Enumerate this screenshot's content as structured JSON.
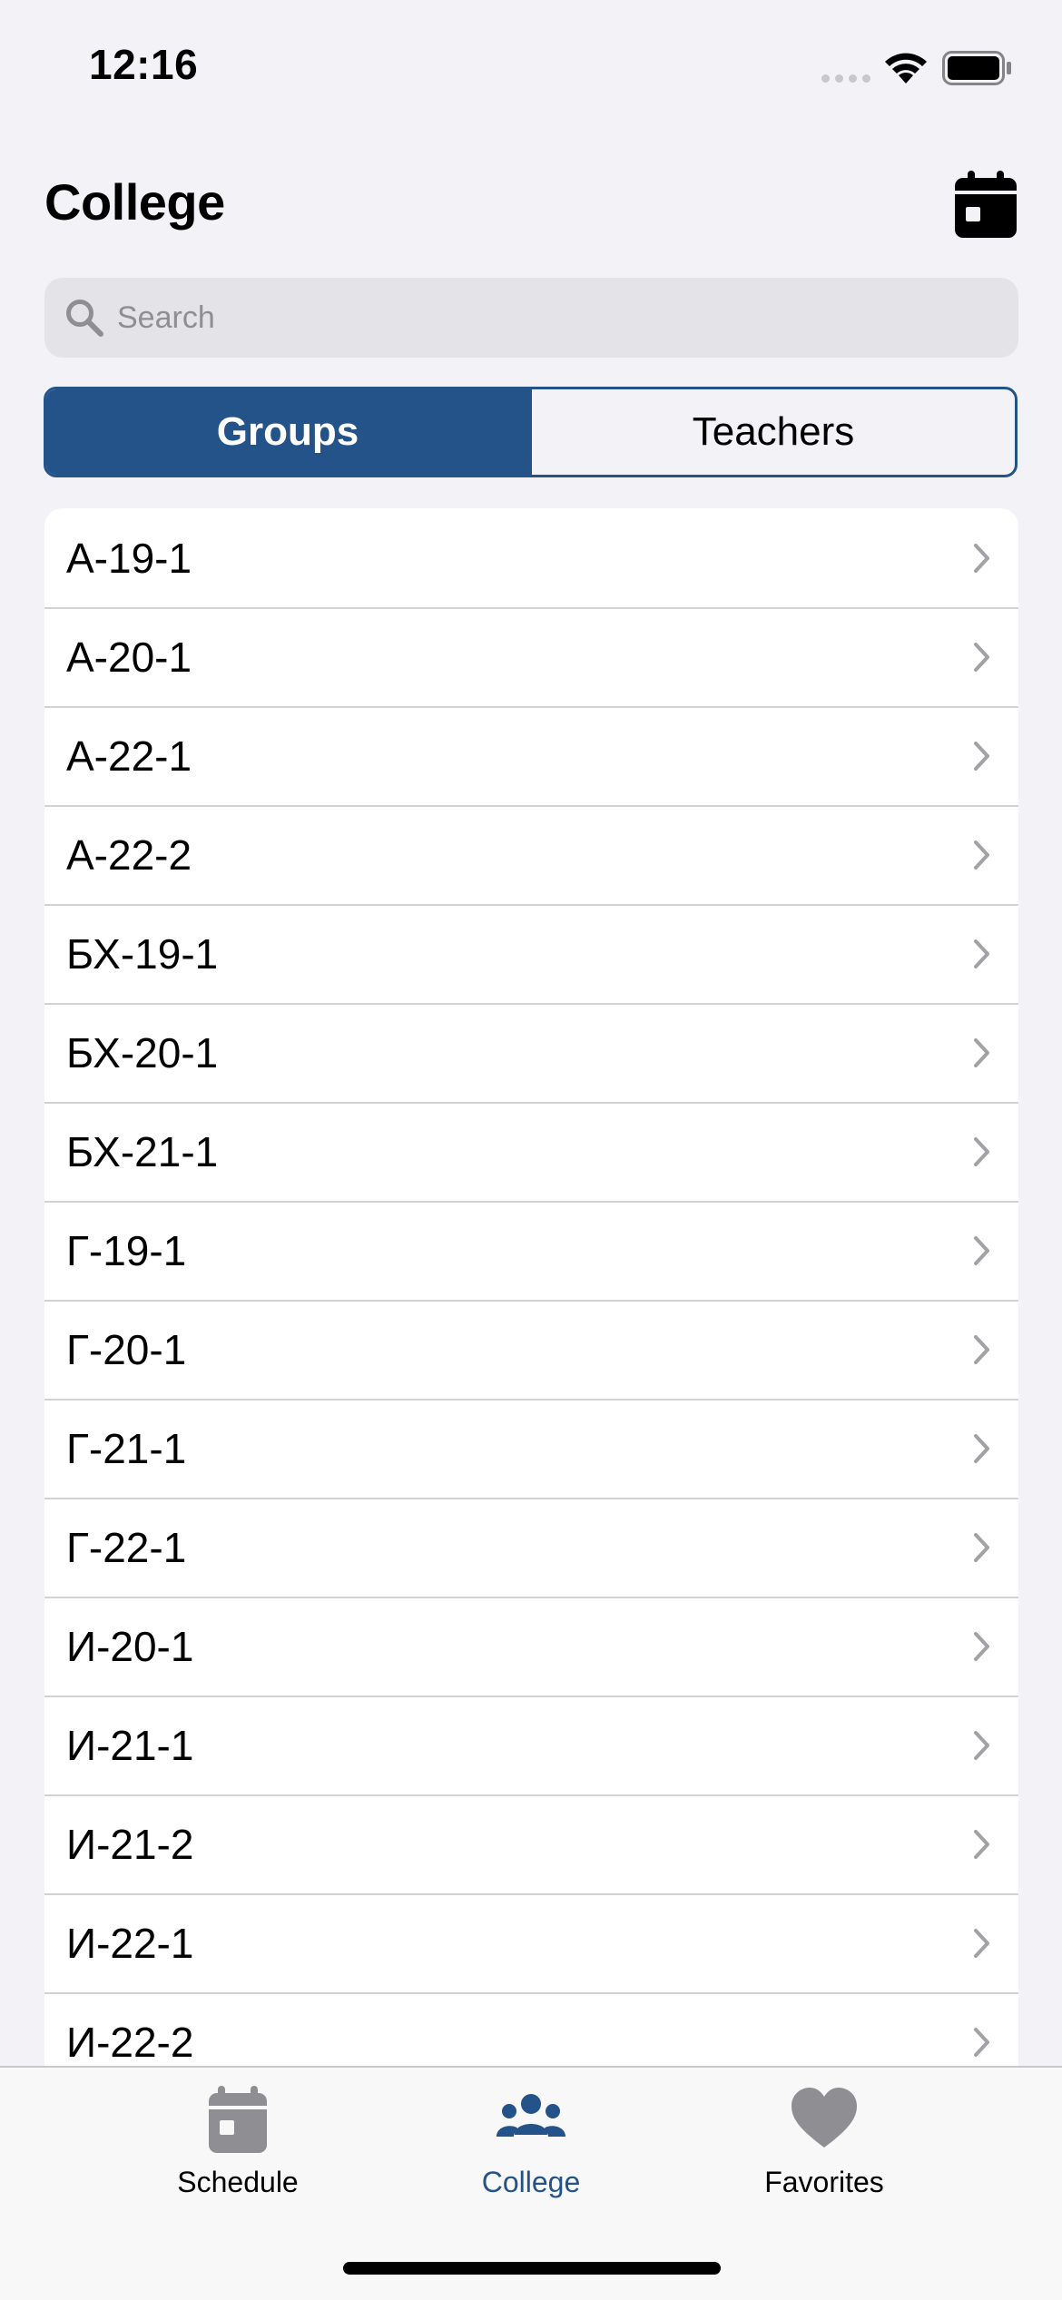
{
  "status_bar": {
    "time": "12:16"
  },
  "header": {
    "title": "College",
    "calendar_icon": "calendar-icon"
  },
  "search": {
    "placeholder": "Search",
    "value": ""
  },
  "segmented_control": {
    "groups_label": "Groups",
    "teachers_label": "Teachers",
    "selected": "Groups"
  },
  "groups": [
    "А-19-1",
    "А-20-1",
    "А-22-1",
    "А-22-2",
    "БХ-19-1",
    "БХ-20-1",
    "БХ-21-1",
    "Г-19-1",
    "Г-20-1",
    "Г-21-1",
    "Г-22-1",
    "И-20-1",
    "И-21-1",
    "И-21-2",
    "И-22-1",
    "И-22-2"
  ],
  "tab_bar": {
    "schedule_label": "Schedule",
    "college_label": "College",
    "favorites_label": "Favorites",
    "selected": "College"
  },
  "colors": {
    "accent": "#235389",
    "background": "#f2f2f7",
    "separator": "#d1d1d6"
  }
}
